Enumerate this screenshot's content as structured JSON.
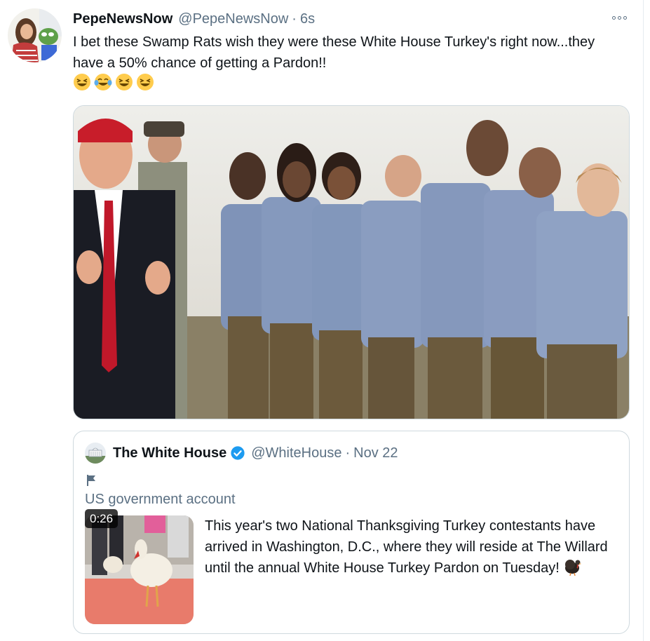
{
  "tweet": {
    "display_name": "PepeNewsNow",
    "handle": "@PepeNewsNow",
    "separator": "·",
    "time": "6s",
    "text": "I bet these Swamp Rats wish they were these White House Turkey's right now...they have a 50% chance of getting a Pardon!!",
    "emojis": [
      "grinning-squinting-face",
      "face-with-tears-of-joy",
      "grinning-squinting-face",
      "grinning-squinting-face"
    ],
    "media_description_icon": "photo"
  },
  "quote": {
    "display_name": "The White House",
    "handle": "@WhiteHouse",
    "separator": "·",
    "date": "Nov 22",
    "account_label": "US government account",
    "video_duration": "0:26",
    "text": "This year's two National Thanksgiving Turkey contestants have arrived in Washington, D.C., where they will reside at The Willard until the annual White House Turkey Pardon on Tuesday!",
    "trailing_emoji": "turkey"
  },
  "colors": {
    "text_primary": "#0f1419",
    "text_secondary": "#5b7083",
    "border": "#cfd9de",
    "verified_blue": "#1d9bf0",
    "emoji_yellow": "#ffcc4d"
  }
}
